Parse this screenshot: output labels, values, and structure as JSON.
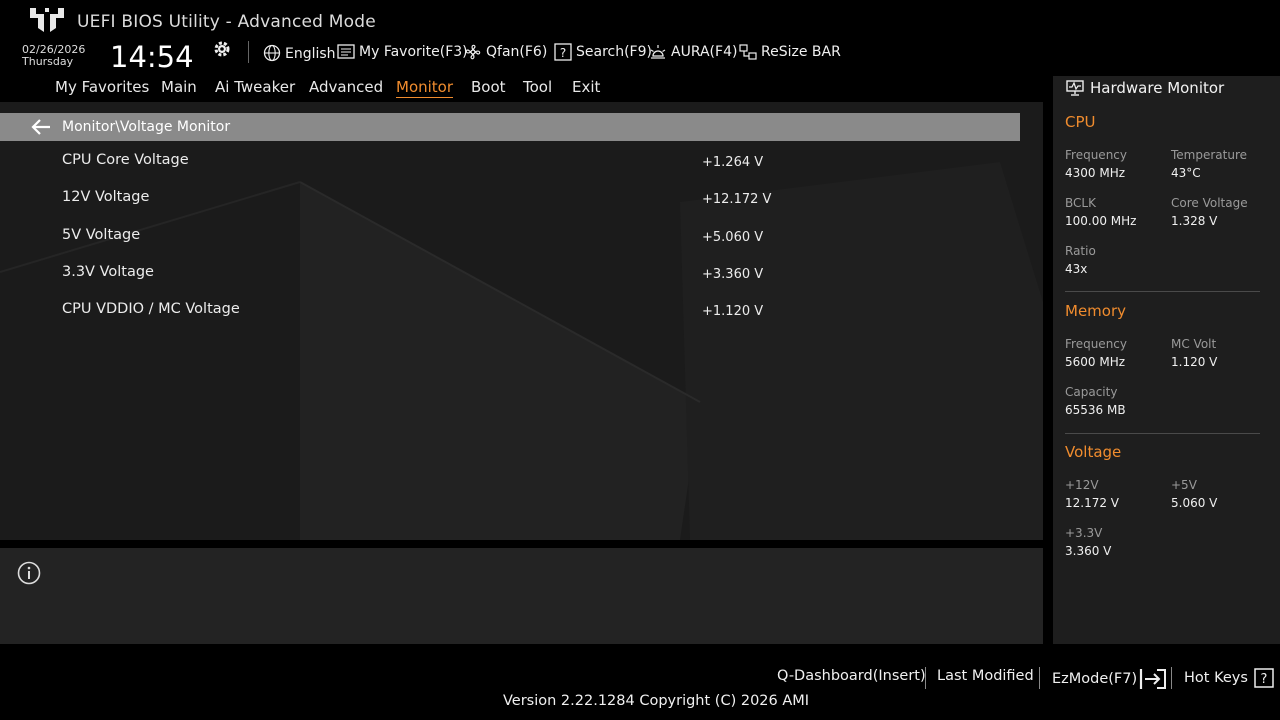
{
  "header": {
    "title": "UEFI BIOS Utility - Advanced Mode",
    "date": "02/26/2026",
    "day": "Thursday",
    "time": "14:54"
  },
  "toolbar": {
    "language": "English",
    "favorite": "My Favorite(F3)",
    "qfan": "Qfan(F6)",
    "search": "Search(F9)",
    "aura": "AURA(F4)",
    "resize_bar": "ReSize BAR"
  },
  "menu": {
    "items": [
      "My Favorites",
      "Main",
      "Ai Tweaker",
      "Advanced",
      "Monitor",
      "Boot",
      "Tool",
      "Exit"
    ],
    "active": "Monitor"
  },
  "breadcrumb": "Monitor\\Voltage Monitor",
  "voltages": [
    {
      "label": "CPU Core Voltage",
      "value": "+1.264 V"
    },
    {
      "label": "12V Voltage",
      "value": "+12.172 V"
    },
    {
      "label": "5V Voltage",
      "value": "+5.060 V"
    },
    {
      "label": "3.3V Voltage",
      "value": "+3.360 V"
    },
    {
      "label": "CPU VDDIO / MC Voltage",
      "value": "+1.120 V"
    }
  ],
  "hw": {
    "title": "Hardware Monitor",
    "cpu": {
      "heading": "CPU",
      "freq_label": "Frequency",
      "freq": "4300 MHz",
      "temp_label": "Temperature",
      "temp": "43°C",
      "bclk_label": "BCLK",
      "bclk": "100.00 MHz",
      "corev_label": "Core Voltage",
      "corev": "1.328 V",
      "ratio_label": "Ratio",
      "ratio": "43x"
    },
    "memory": {
      "heading": "Memory",
      "freq_label": "Frequency",
      "freq": "5600 MHz",
      "mcvolt_label": "MC Volt",
      "mcvolt": "1.120 V",
      "cap_label": "Capacity",
      "cap": "65536 MB"
    },
    "voltage": {
      "heading": "Voltage",
      "v12_label": "+12V",
      "v12": "12.172 V",
      "v5_label": "+5V",
      "v5": "5.060 V",
      "v33_label": "+3.3V",
      "v33": "3.360 V"
    }
  },
  "footer": {
    "qdash": "Q-Dashboard(Insert)",
    "last_modified": "Last Modified",
    "ezmode": "EzMode(F7)",
    "hotkeys": "Hot Keys",
    "version": "Version 2.22.1284 Copyright (C) 2026 AMI"
  },
  "colors": {
    "accent": "#f08c2e",
    "breadcrumb_bg": "#8a8a8a",
    "panel_bg": "#1b1b1b"
  }
}
